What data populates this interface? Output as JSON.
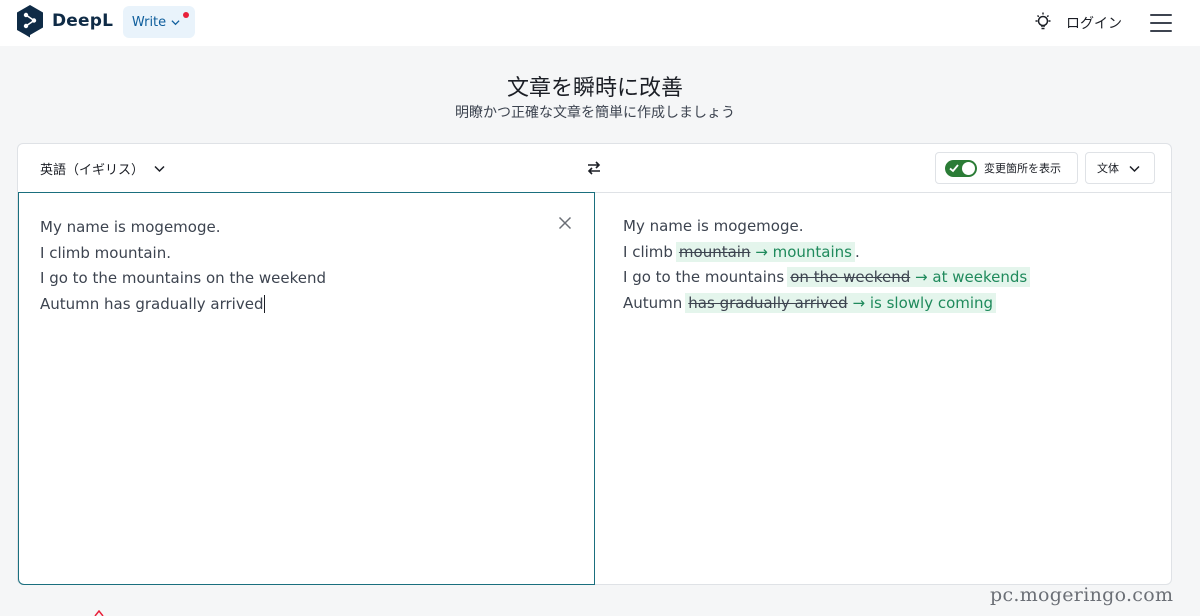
{
  "header": {
    "brand": "DeepL",
    "write_label": "Write",
    "login_label": "ログイン"
  },
  "hero": {
    "title": "文章を瞬時に改善",
    "subtitle": "明瞭かつ正確な文章を簡単に作成しましょう"
  },
  "toolbar": {
    "language": "英語（イギリス）",
    "show_changes_label": "変更箇所を表示",
    "show_changes_on": true,
    "style_label": "文体"
  },
  "source": {
    "lines": [
      "My name is mogemoge.",
      "I climb mountain.",
      "I go to the mountains on the weekend",
      "Autumn has gradually arrived"
    ]
  },
  "output": {
    "line1": "My name is mogemoge.",
    "line2": {
      "prefix": "I climb",
      "removed": "mountain",
      "arrow": "→",
      "added": "mountains",
      "suffix": "."
    },
    "line3": {
      "prefix": "I go to the mountains",
      "removed": "on the weekend",
      "arrow": "→",
      "added": "at weekends",
      "suffix": ""
    },
    "line4": {
      "prefix": "Autumn",
      "removed": "has gradually arrived",
      "arrow": "→",
      "added": "is slowly coming",
      "suffix": ""
    }
  },
  "watermark": "pc.mogeringo.com",
  "colors": {
    "accent_blue": "#0f5e9c",
    "toggle_green": "#2b7c36",
    "change_bg": "#e4f5ec",
    "inserted_text": "#1f8a5c",
    "source_border": "#1a6f7e",
    "notification_dot": "#e8203a"
  },
  "icons": [
    "deepl-logo-icon",
    "chevron-down-icon",
    "lightbulb-icon",
    "hamburger-menu-icon",
    "swap-icon",
    "check-icon",
    "close-icon"
  ]
}
